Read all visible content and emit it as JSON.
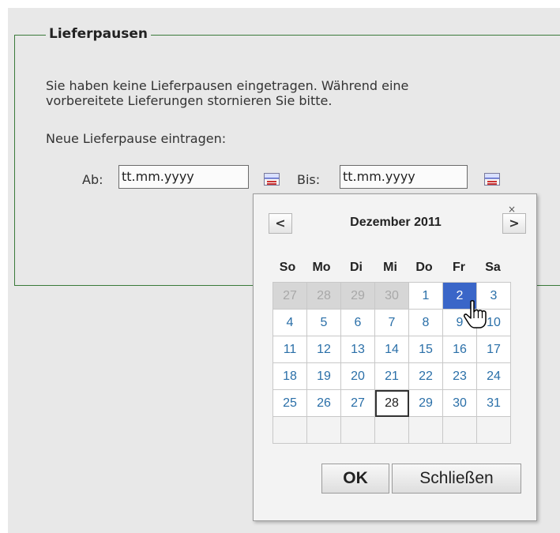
{
  "section": {
    "legend": "Lieferpausen",
    "line1": "Sie haben keine Lieferpausen eingetragen. Während eine",
    "line2": "vorbereitete Lieferungen stornieren Sie bitte.",
    "line3": "Neue Lieferpause eintragen:"
  },
  "form": {
    "from_label": "Ab:",
    "from_value": "tt.mm.yyyy",
    "to_label": "Bis:",
    "to_value": "tt.mm.yyyy"
  },
  "calendar": {
    "prev": "<",
    "next": ">",
    "close": "×",
    "month": "Dezember 2011",
    "weekdays": [
      "So",
      "Mo",
      "Di",
      "Mi",
      "Do",
      "Fr",
      "Sa"
    ],
    "days": [
      "27",
      "28",
      "29",
      "30",
      "1",
      "2",
      "3",
      "4",
      "5",
      "6",
      "7",
      "8",
      "9",
      "10",
      "11",
      "12",
      "13",
      "14",
      "15",
      "16",
      "17",
      "18",
      "19",
      "20",
      "21",
      "22",
      "23",
      "24",
      "25",
      "26",
      "27",
      "28",
      "29",
      "30",
      "31"
    ],
    "ok": "OK",
    "close_button": "Schließen",
    "colors": {
      "selected": "#3a66c8",
      "day_text": "#2a6fa8",
      "other_month_bg": "#d6d6d6"
    }
  }
}
